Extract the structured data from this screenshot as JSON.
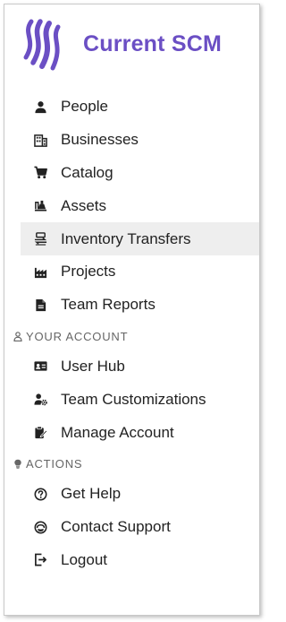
{
  "brand": {
    "name": "Current SCM",
    "color": "#6b4fc4",
    "logo_icon": "wave-stripes-logo"
  },
  "nav": {
    "main_items": [
      {
        "label": "People",
        "icon": "person-icon"
      },
      {
        "label": "Businesses",
        "icon": "building-icon"
      },
      {
        "label": "Catalog",
        "icon": "cart-icon"
      },
      {
        "label": "Assets",
        "icon": "assets-icon"
      },
      {
        "label": "Inventory Transfers",
        "icon": "transfer-icon",
        "active": true
      },
      {
        "label": "Projects",
        "icon": "industry-icon"
      },
      {
        "label": "Team Reports",
        "icon": "file-icon"
      }
    ],
    "account_section": {
      "title": "YOUR ACCOUNT",
      "icon": "user-small-icon",
      "items": [
        {
          "label": "User Hub",
          "icon": "id-card-icon"
        },
        {
          "label": "Team Customizations",
          "icon": "user-gear-icon"
        },
        {
          "label": "Manage Account",
          "icon": "clipboard-pen-icon"
        }
      ]
    },
    "actions_section": {
      "title": "ACTIONS",
      "icon": "lightbulb-icon",
      "items": [
        {
          "label": "Get Help",
          "icon": "question-circle-icon"
        },
        {
          "label": "Contact Support",
          "icon": "support-icon"
        },
        {
          "label": "Logout",
          "icon": "logout-icon"
        }
      ]
    }
  },
  "colors": {
    "active_background": "#eeeeee",
    "text": "#222222",
    "section_text": "#666666"
  }
}
